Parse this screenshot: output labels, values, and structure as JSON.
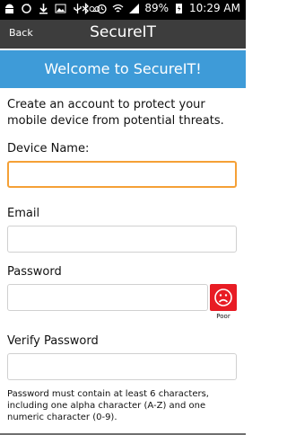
{
  "status_bar": {
    "battery_percent": "89%",
    "time": "10:29 AM"
  },
  "app_bar": {
    "back_label": "Back",
    "title": "SecureIT"
  },
  "banner": {
    "text": "Welcome to SecureIT!"
  },
  "intro": {
    "text": "Create an account to protect your mobile device from potential threats."
  },
  "form": {
    "device_name": {
      "label": "Device Name:",
      "value": ""
    },
    "email": {
      "label": "Email",
      "value": ""
    },
    "password": {
      "label": "Password",
      "value": "",
      "strength": "Poor"
    },
    "verify_password": {
      "label": "Verify Password",
      "value": ""
    },
    "help_text": "Password must contain at least 6 characters, including one alpha character (A-Z) and one numeric character (0-9)."
  },
  "colors": {
    "banner": "#3e9bd8",
    "focus_border": "#f5a036",
    "strength_poor": "#e81c24",
    "app_bar": "#3d3d3d"
  }
}
